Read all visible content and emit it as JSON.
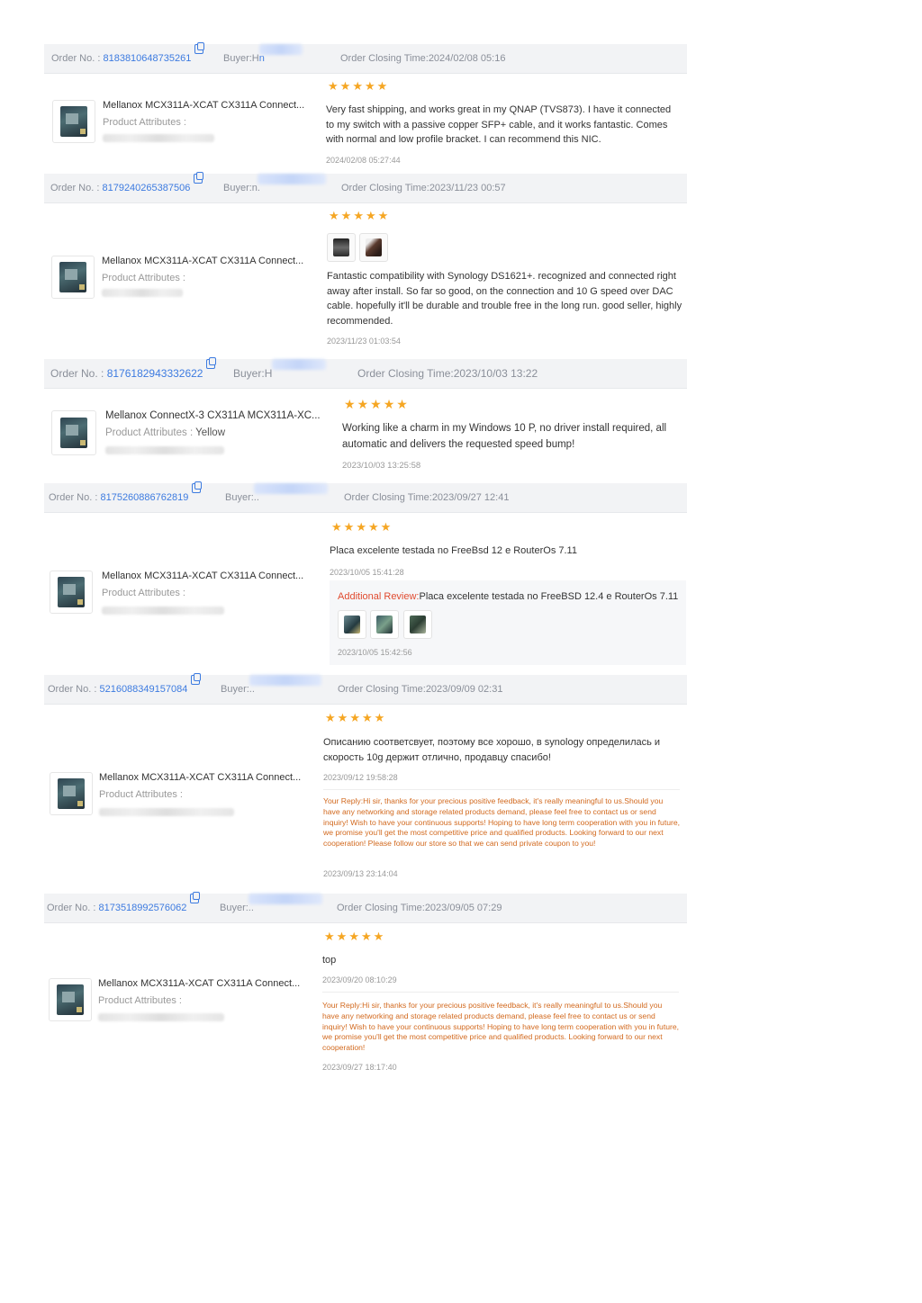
{
  "labels": {
    "order_no": "Order No. :",
    "buyer": "Buyer:",
    "closing": "Order Closing Time:",
    "product_attributes": "Product Attributes :",
    "additional_review": "Additional Review:",
    "your_reply": "Your Reply:"
  },
  "orders": [
    {
      "order_number": "8183810648735261",
      "buyer_visible_start": "H",
      "buyer_visible_end": "n",
      "closing_time": "2024/02/08 05:16",
      "product_title": "Mellanox MCX311A-XCAT CX311A Connect...",
      "product_attribute_value": "",
      "rating": 5,
      "review_text": "Very fast shipping, and works great in my QNAP (TVS873). I have it connected to my switch with a passive copper SFP+ cable, and it works fantastic. Comes with normal and low profile bracket. I can recommend this NIC.",
      "review_date": "2024/02/08 05:27:44"
    },
    {
      "order_number": "8179240265387506",
      "buyer_visible_start": "n",
      "buyer_visible_end": ".",
      "closing_time": "2023/11/23 00:57",
      "product_title": "Mellanox MCX311A-XCAT CX311A Connect...",
      "product_attribute_value": "",
      "rating": 5,
      "photo_count": 2,
      "review_text": "Fantastic compatibility with Synology DS1621+. recognized and connected right away after install. So far so good, on the connection and 10 G speed over DAC cable. hopefully it'll be durable and trouble free in the long run. good seller, highly recommended.",
      "review_date": "2023/11/23 01:03:54"
    },
    {
      "order_number": "8176182943332622",
      "buyer_visible_start": "H",
      "buyer_visible_end": "",
      "closing_time": "2023/10/03 13:22",
      "product_title": "Mellanox ConnectX-3 CX311A MCX311A-XC...",
      "product_attribute_value": "Yellow",
      "rating": 5,
      "review_text": "Working like a charm in my Windows 10 P, no driver install required, all automatic and delivers the requested speed bump!",
      "review_date": "2023/10/03 13:25:58"
    },
    {
      "order_number": "8175260886762819",
      "buyer_visible_start": "",
      "buyer_visible_end": "..",
      "closing_time": "2023/09/27 12:41",
      "product_title": "Mellanox MCX311A-XCAT CX311A Connect...",
      "product_attribute_value": "",
      "rating": 5,
      "review_text": "Placa excelente testada no FreeBsd 12 e RouterOs 7.11",
      "review_date": "2023/10/05 15:41:28",
      "additional_review_text": "Placa excelente testada no FreeBSD 12.4 e RouterOs 7.11",
      "additional_photo_count": 3,
      "additional_review_date": "2023/10/05 15:42:56"
    },
    {
      "order_number": "5216088349157084",
      "buyer_visible_start": "",
      "buyer_visible_end": "..",
      "closing_time": "2023/09/09 02:31",
      "product_title": "Mellanox MCX311A-XCAT CX311A Connect...",
      "product_attribute_value": "",
      "rating": 5,
      "review_text": "Описанию соответсвует, поэтому все хорошо, в synology определилась и скорость 10g держит отлично, продавцу спасибо!",
      "review_date": "2023/09/12 19:58:28",
      "reply_text": "Hi sir, thanks for your precious positive feedback, it's really meaningful to us.Should you have any networking and storage related products demand, please feel free to contact us or send inquiry! Wish to have your continuous supports! Hoping to have long term cooperation with you in future, we promise you'll get the most competitive price and qualified products. Looking forward to our next cooperation! Please follow our store so that we can send private coupon to you!",
      "reply_date": "2023/09/13 23:14:04"
    },
    {
      "order_number": "8173518992576062",
      "buyer_visible_start": "",
      "buyer_visible_end": "..",
      "closing_time": "2023/09/05 07:29",
      "product_title": "Mellanox MCX311A-XCAT CX311A Connect...",
      "product_attribute_value": "",
      "rating": 5,
      "review_text": "top",
      "review_date": "2023/09/20 08:10:29",
      "reply_text": "Hi sir, thanks for your precious positive feedback, it's really meaningful to us.Should you have any networking and storage related products demand, please feel free to contact us or send inquiry! Wish to have your continuous supports! Hoping to have long term cooperation with you in future, we promise you'll get the most competitive price and qualified products. Looking forward to our next cooperation!",
      "reply_date": "2023/09/27 18:17:40"
    }
  ],
  "colors": {
    "link_blue": "#3d7be0",
    "star_orange": "#f5a623",
    "reply_orange": "#d2691e",
    "additional_red": "#e04a2f",
    "header_bg": "#f2f3f5"
  },
  "icons": {
    "copy": "copy-icon",
    "star": "star-icon"
  }
}
